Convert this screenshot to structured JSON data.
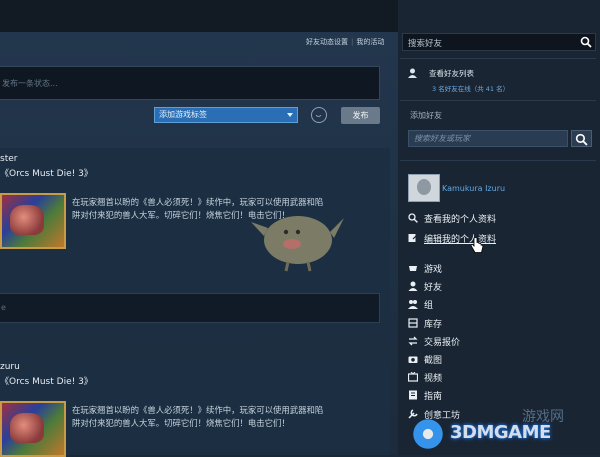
{
  "header": {
    "activity_links": [
      "好友动态设置",
      "我的活动"
    ]
  },
  "composer": {
    "status_placeholder": "发布一条状态...",
    "tag_select_value": "添加游戏标签",
    "post_label": "发布"
  },
  "feed": [
    {
      "user": "ster",
      "game": "《Orcs Must Die! 3》",
      "description_lines": [
        "在玩家翘首以盼的《兽人必须死！》续作中，玩家可以使用武器和陷",
        "阱对付来犯的兽人大军。切碎它们！烧焦它们！电击它们！"
      ],
      "comment_placeholder": "e"
    },
    {
      "user": "zuru",
      "game": "《Orcs Must Die! 3》",
      "description_lines": [
        "在玩家翘首以盼的《兽人必须死！》续作中，玩家可以使用武器和陷",
        "阱对付来犯的兽人大军。切碎它们！烧焦它们！电击它们！"
      ]
    }
  ],
  "sidebar": {
    "search_placeholder": "搜索好友",
    "friends_list_label": "查看好友列表",
    "friends_online": "3 名好友在线（共 41 名）",
    "add_friend_label": "添加好友",
    "add_friend_placeholder": "搜索好友或玩家",
    "profile_name": "Kamukura Izuru",
    "menu": [
      {
        "label": "查看我的个人资料",
        "icon": "search-icon"
      },
      {
        "label": "编辑我的个人资料",
        "icon": "edit-icon"
      },
      {
        "label": "游戏",
        "icon": "gamepad-icon"
      },
      {
        "label": "好友",
        "icon": "person-icon"
      },
      {
        "label": "组",
        "icon": "group-icon"
      },
      {
        "label": "库存",
        "icon": "inventory-icon"
      },
      {
        "label": "交易报价",
        "icon": "trade-icon"
      },
      {
        "label": "截图",
        "icon": "camera-icon"
      },
      {
        "label": "视频",
        "icon": "tv-icon"
      },
      {
        "label": "指南",
        "icon": "book-icon"
      },
      {
        "label": "创意工坊",
        "icon": "workshop-icon"
      }
    ]
  },
  "watermark": {
    "text": "3DMGAME",
    "cn": "游戏网"
  },
  "colors": {
    "background": "#1b2838",
    "accent_blue": "#2a6fb5",
    "link_blue": "#62a8e3"
  }
}
